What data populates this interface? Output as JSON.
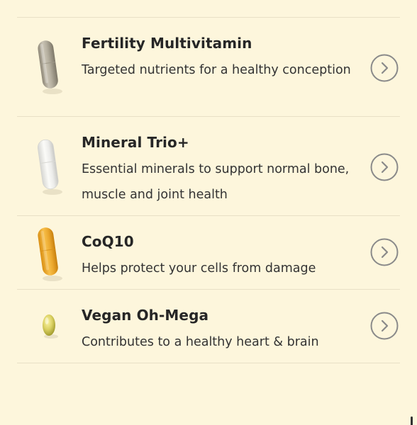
{
  "products": [
    {
      "name": "Fertility Multivitamin",
      "description": "Targeted nutrients for a healthy conception",
      "icon": "beige-capsule-icon"
    },
    {
      "name": "Mineral Trio+",
      "description": "Essential minerals to support normal bone, muscle and joint health",
      "icon": "white-capsule-icon"
    },
    {
      "name": "CoQ10",
      "description": "Helps protect your cells from damage",
      "icon": "yellow-capsule-icon"
    },
    {
      "name": "Vegan Oh-Mega",
      "description": "Contributes to a healthy heart & brain",
      "icon": "softgel-icon"
    }
  ],
  "colors": {
    "background": "#fdf6dc",
    "divider": "#e8e0c6",
    "chevron": "#8a8a8a"
  }
}
